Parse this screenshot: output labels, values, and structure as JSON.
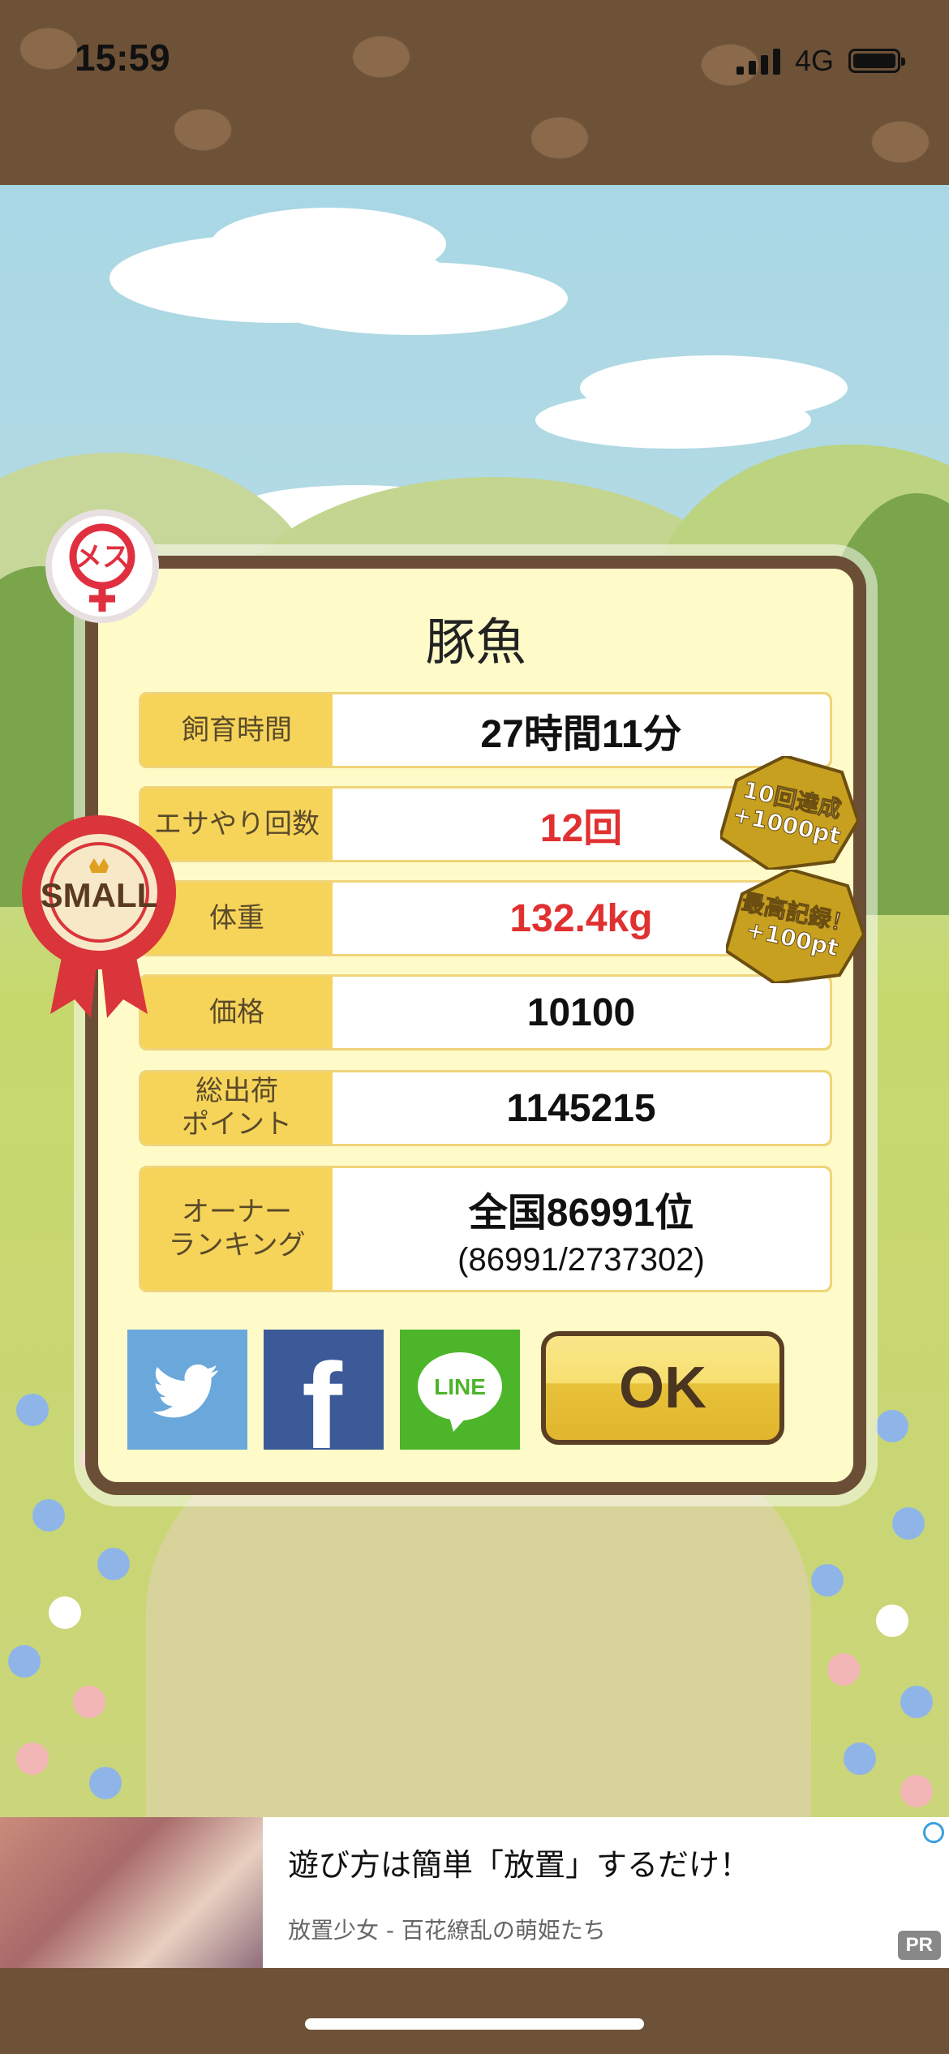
{
  "status_bar": {
    "time": "15:59",
    "network": "4G"
  },
  "dialog": {
    "title": "豚魚",
    "rows": [
      {
        "label": "飼育時間",
        "value": "27時間11分"
      },
      {
        "label": "エサやり回数",
        "value": "12回"
      },
      {
        "label": "体重",
        "value": "132.4kg"
      },
      {
        "label": "価格",
        "value": "10100"
      },
      {
        "label": "総出荷\nポイント",
        "value": "1145215"
      },
      {
        "label": "オーナー\nランキング",
        "value": "全国86991位",
        "sub": "(86991/2737302)"
      }
    ],
    "social": {
      "twitter": "twitter-icon",
      "facebook": "f",
      "line": "LINE"
    },
    "ok_label": "OK"
  },
  "badges": {
    "gender": "メス",
    "size": "SMALL",
    "achievement_1": {
      "line1": "10回達成",
      "line2": "+1000pt"
    },
    "achievement_2": {
      "line1": "最高記録！",
      "line2": "+100pt"
    }
  },
  "ad": {
    "title": "遊び方は簡単「放置」するだけ！",
    "subtitle": "放置少女 - 百花繚乱の萌姫たち",
    "pr": "PR"
  },
  "colors": {
    "frame": "#6b4e36",
    "panel": "#fefbc8",
    "label_bg": "#f6d45a",
    "highlight": "#e03030"
  }
}
